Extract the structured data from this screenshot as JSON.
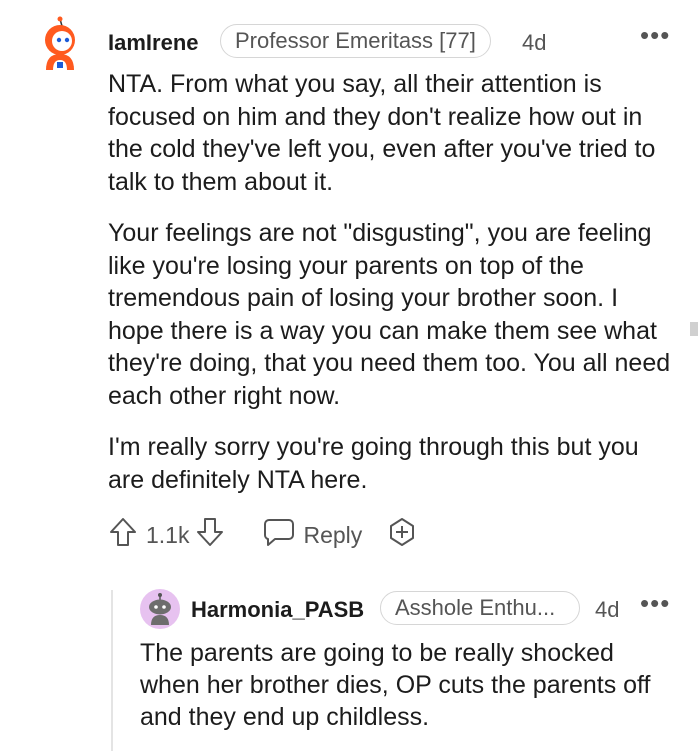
{
  "comment": {
    "username": "IamIrene",
    "flair": "Professor Emeritass [77]",
    "time": "4d",
    "more_icon": "more-dots-icon",
    "paragraphs": [
      "NTA. From what you say, all their attention is focused on him and they don't realize how out in the cold they've left you, even after you've tried to talk to them about it.",
      "Your feelings are not \"disgusting\", you are feeling like you're losing your parents on top of the tremendous pain of losing your brother soon. I hope there is a way you can make them see what they're doing, that you need them too. You all need each other right now.",
      "I'm really sorry you're going through this but you are definitely NTA here."
    ],
    "actions": {
      "upvote_icon": "upvote-arrow-icon",
      "score": "1.1k",
      "downvote_icon": "downvote-arrow-icon",
      "reply_icon": "speech-bubble-icon",
      "reply_label": "Reply",
      "award_icon": "award-plus-icon"
    }
  },
  "reply": {
    "username": "Harmonia_PASB",
    "flair": "Asshole Enthu...",
    "time": "4d",
    "text": "The parents are going to be really shocked when her brother dies, OP cuts the parents off and they end up childless."
  },
  "colors": {
    "text": "#1c1c1c",
    "meta": "#555555",
    "border": "#d6d6d6",
    "avatar_orange": "#ff5a1f",
    "avatar2_bg": "#e7c2f0"
  }
}
